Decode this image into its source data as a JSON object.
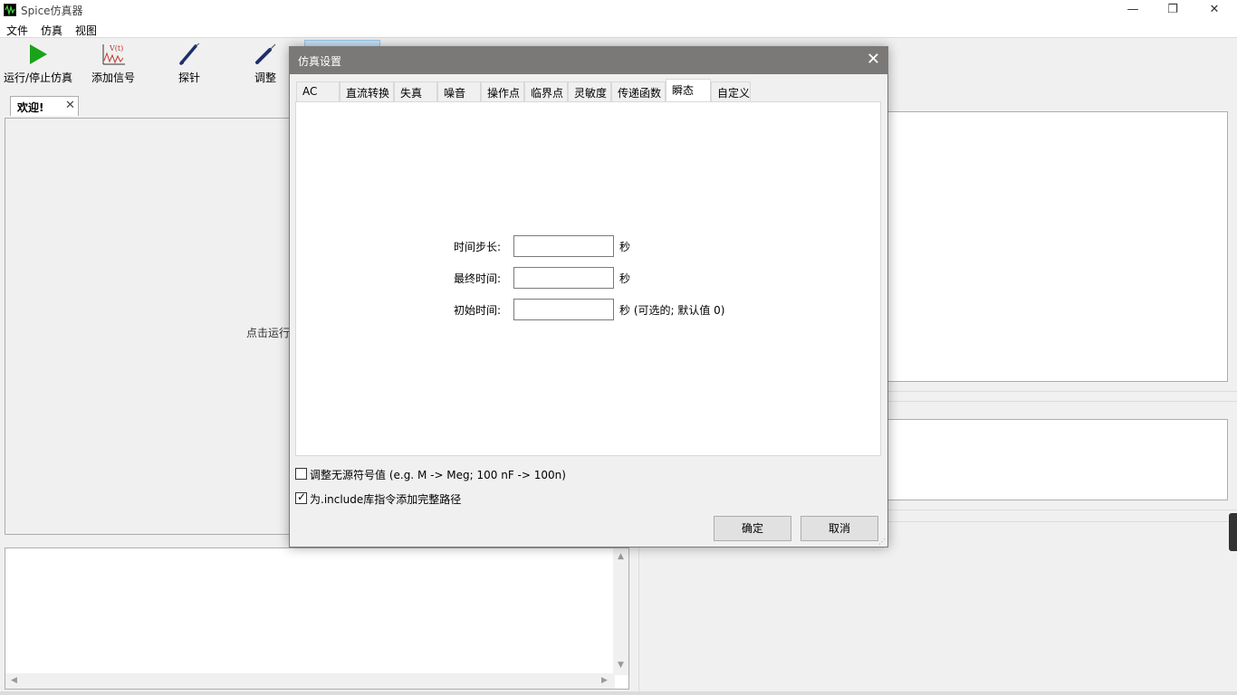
{
  "app": {
    "title": "Spice仿真器"
  },
  "window_controls": {
    "minimize": "—",
    "restore": "❐",
    "close": "✕"
  },
  "menu": [
    "文件",
    "仿真",
    "视图"
  ],
  "toolbar": [
    {
      "label": "运行/停止仿真",
      "icon": "play-icon"
    },
    {
      "label": "添加信号",
      "icon": "add-signal-icon"
    },
    {
      "label": "探针",
      "icon": "probe-icon"
    },
    {
      "label": "调整",
      "icon": "tune-icon"
    }
  ],
  "colors": {
    "play": "#1aa31a",
    "dialog_title": "#7b7878",
    "pen": "#1f2f6b"
  },
  "doc": {
    "tab_label": "欢迎!",
    "close": "✕",
    "hint": "点击运行"
  },
  "dialog": {
    "title": "仿真设置",
    "close": "✕",
    "tabs": [
      "AC",
      "直流转换",
      "失真",
      "噪音",
      "操作点",
      "临界点",
      "灵敏度",
      "传递函数",
      "瞬态",
      "自定义"
    ],
    "active_tab": "瞬态",
    "fields": [
      {
        "label": "时间步长:",
        "value": "",
        "unit": "秒"
      },
      {
        "label": "最终时间:",
        "value": "",
        "unit": "秒"
      },
      {
        "label": "初始时间:",
        "value": "",
        "unit": "秒  (可选的; 默认值 0)"
      }
    ],
    "checkboxes": [
      {
        "label": "调整无源符号值 (e.g. M -> Meg; 100 nF -> 100n)",
        "checked": false
      },
      {
        "label": "为.include库指令添加完整路径",
        "checked": true
      }
    ],
    "ok": "确定",
    "cancel": "取消"
  }
}
